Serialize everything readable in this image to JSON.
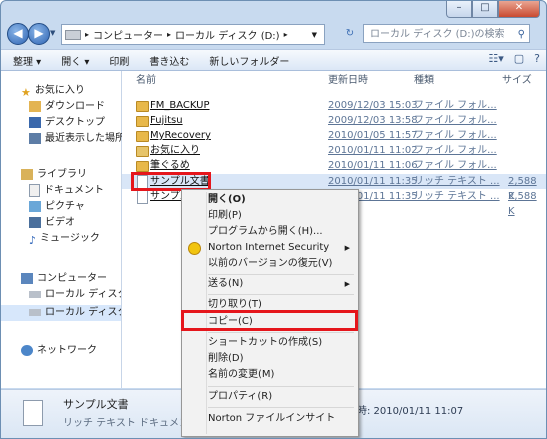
{
  "window": {
    "caption_buttons": [
      "–",
      "□",
      "✕"
    ]
  },
  "address": {
    "path": [
      "コンピューター",
      "ローカル ディスク (D:)"
    ],
    "search_placeholder": "ローカル ディスク (D:)の検索"
  },
  "toolbar": {
    "organize": "整理 ▾",
    "open": "開く ▾",
    "print": "印刷",
    "burn": "書き込む",
    "new_folder": "新しいフォルダー"
  },
  "nav": {
    "favorites": "お気に入り",
    "downloads": "ダウンロード",
    "desktop": "デスクトップ",
    "recent": "最近表示した場所",
    "libraries": "ライブラリ",
    "documents": "ドキュメント",
    "pictures": "ピクチャ",
    "videos": "ビデオ",
    "music": "ミュージック",
    "computer": "コンピューター",
    "local_c": "ローカル ディスク (",
    "local_d": "ローカル ディスク (",
    "network": "ネットワーク"
  },
  "columns": {
    "name": "名前",
    "date": "更新日時",
    "type": "種類",
    "size": "サイズ"
  },
  "files": [
    {
      "name": "FM_BACKUP",
      "date": "2009/12/03 15:03",
      "type": "ファイル フォル...",
      "size": ""
    },
    {
      "name": "Fujitsu",
      "date": "2009/12/03 13:58",
      "type": "ファイル フォル...",
      "size": ""
    },
    {
      "name": "MyRecovery",
      "date": "2010/01/05 11:57",
      "type": "ファイル フォル...",
      "size": ""
    },
    {
      "name": "お気に入り",
      "date": "2010/01/11 11:02",
      "type": "ファイル フォル...",
      "size": ""
    },
    {
      "name": "筆ぐるめ",
      "date": "2010/01/11 11:06",
      "type": "ファイル フォル...",
      "size": ""
    },
    {
      "name": "サンプル文書",
      "date": "2010/01/11 11:35",
      "type": "リッチ テキスト ...",
      "size": "2,588 K"
    },
    {
      "name": "サンプル",
      "date": "2010/01/11 11:35",
      "type": "リッチ テキスト ...",
      "size": "2,588 K"
    }
  ],
  "context_menu": {
    "open": "開く(O)",
    "print": "印刷(P)",
    "open_with": "プログラムから開く(H)...",
    "norton": "Norton Internet Security",
    "restore": "以前のバージョンの復元(V)",
    "send_to": "送る(N)",
    "cut": "切り取り(T)",
    "copy": "コピー(C)",
    "shortcut": "ショートカットの作成(S)",
    "delete": "削除(D)",
    "rename": "名前の変更(M)",
    "properties": "プロパティ(R)",
    "norton_insight": "Norton ファイルインサイト"
  },
  "details": {
    "name": "サンプル文書",
    "type": "リッチ テキスト ドキュメント",
    "modified": "時: 2010/01/11 11:07"
  },
  "colors": {
    "highlight_red": "#e5161c",
    "window_frame": "#c8daef",
    "selection": "#d9e6f7"
  }
}
